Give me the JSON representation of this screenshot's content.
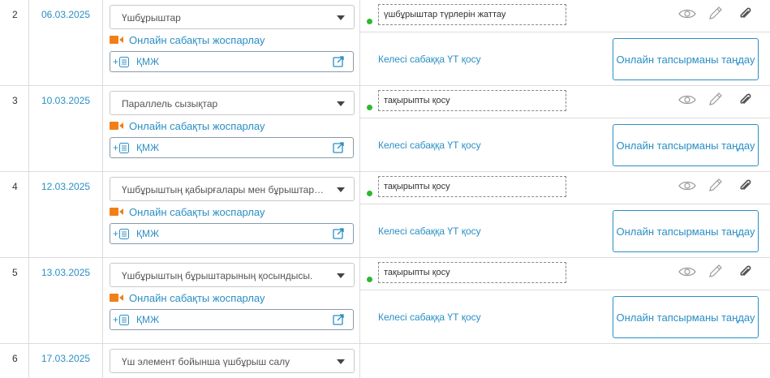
{
  "rows": [
    {
      "num": "2",
      "date": "06.03.2025",
      "topic": "Үшбұрыштар",
      "online_label": "Онлайн сабақты жоспарлау",
      "kmzh_label": "ҚМЖ",
      "homework": "үшбұрыштар түрлерін жаттау",
      "next_label": "Келесі сабаққа ҮТ қосу",
      "choose_label": "Онлайн тапсырманы таңдау"
    },
    {
      "num": "3",
      "date": "10.03.2025",
      "topic": "Параллель сызықтар",
      "online_label": "Онлайн сабақты жоспарлау",
      "kmzh_label": "ҚМЖ",
      "homework": "тақырыпты қосу",
      "next_label": "Келесі сабаққа ҮТ қосу",
      "choose_label": "Онлайн тапсырманы таңдау"
    },
    {
      "num": "4",
      "date": "12.03.2025",
      "topic": "Үшбұрыштың қабырғалары мен бұрыштары а...",
      "online_label": "Онлайн сабақты жоспарлау",
      "kmzh_label": "ҚМЖ",
      "homework": "тақырыпты қосу",
      "next_label": "Келесі сабаққа ҮТ қосу",
      "choose_label": "Онлайн тапсырманы таңдау"
    },
    {
      "num": "5",
      "date": "13.03.2025",
      "topic": "Үшбұрыштың бұрыштарының қосындысы.",
      "online_label": "Онлайн сабақты жоспарлау",
      "kmzh_label": "ҚМЖ",
      "homework": "тақырыпты қосу",
      "next_label": "Келесі сабаққа ҮТ қосу",
      "choose_label": "Онлайн тапсырманы таңдау"
    },
    {
      "num": "6",
      "date": "17.03.2025",
      "topic": "Үш элемент бойынша үшбұрыш салу"
    }
  ],
  "icons": {
    "camera": "video-camera-icon",
    "document": "document-add-icon",
    "external": "external-link-icon",
    "eye": "eye-icon",
    "pencil": "pencil-icon",
    "clip": "paperclip-icon"
  },
  "colors": {
    "accent": "#2a8fc4",
    "camera": "#f07f1a",
    "status_dot": "#2eb82e",
    "grid_line": "#dcdcdc"
  }
}
